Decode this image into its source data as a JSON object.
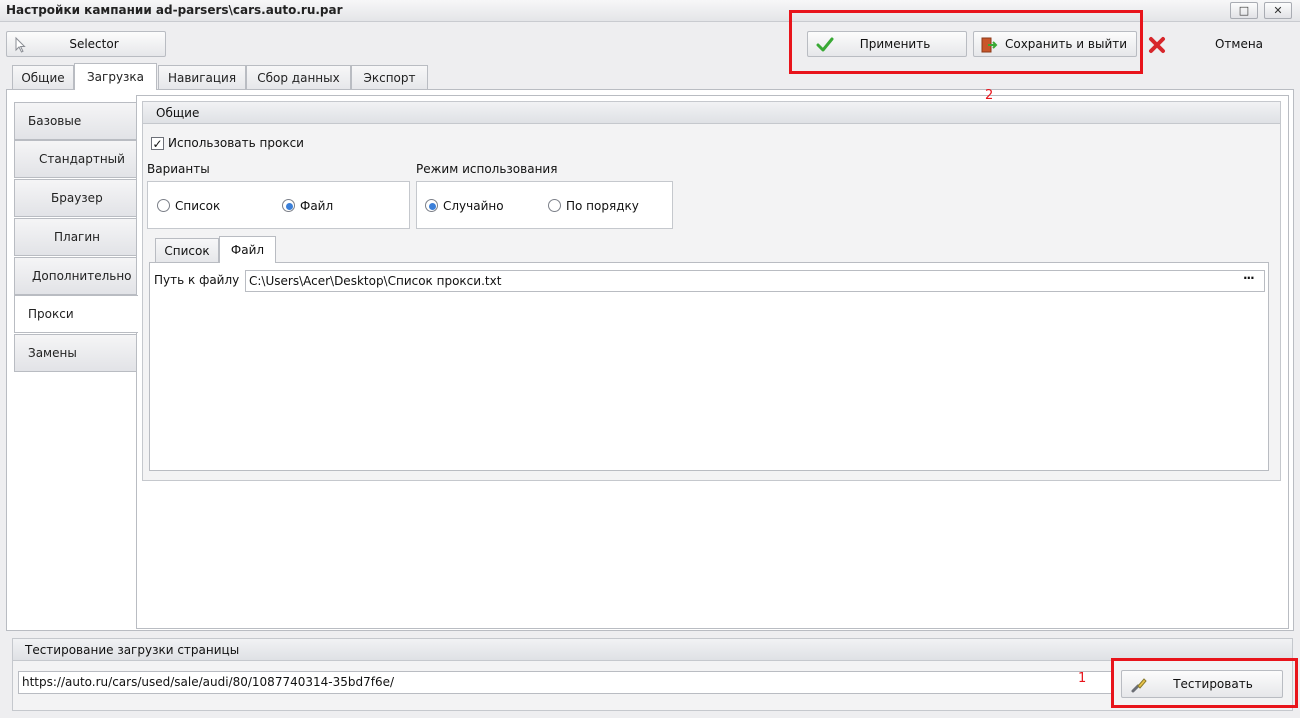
{
  "window": {
    "title": "Настройки кампании ad-parsers\\cars.auto.ru.par",
    "maximize_glyph": "□",
    "close_glyph": "✕"
  },
  "toolbar": {
    "selector_label": "Selector",
    "apply_label": "Применить",
    "save_exit_label": "Сохранить и выйти",
    "cancel_label": "Отмена"
  },
  "tabs": [
    {
      "label": "Общие"
    },
    {
      "label": "Загрузка",
      "active": true
    },
    {
      "label": "Навигация"
    },
    {
      "label": "Сбор данных"
    },
    {
      "label": "Экспорт"
    }
  ],
  "sidebar": {
    "items": [
      {
        "label": "Базовые"
      },
      {
        "label": "Стандартный"
      },
      {
        "label": "Браузер"
      },
      {
        "label": "Плагин"
      },
      {
        "label": "Дополнительно"
      },
      {
        "label": "Прокси",
        "active": true
      },
      {
        "label": "Замены"
      }
    ]
  },
  "proxy": {
    "group_title": "Общие",
    "use_proxy_label": "Использовать прокси",
    "use_proxy_checked": true,
    "variants_label": "Варианты",
    "variant_list": "Список",
    "variant_file": "Файл",
    "selected_variant": "Файл",
    "mode_label": "Режим использования",
    "mode_random": "Случайно",
    "mode_order": "По порядку",
    "selected_mode": "Случайно",
    "subtabs": [
      {
        "label": "Список"
      },
      {
        "label": "Файл",
        "active": true
      }
    ],
    "file_path_label": "Путь к файлу",
    "file_path_value": "C:\\Users\\Acer\\Desktop\\Список прокси.txt",
    "browse_glyph": "···"
  },
  "test": {
    "title": "Тестирование загрузки страницы",
    "url": "https://auto.ru/cars/used/sale/audi/80/1087740314-35bd7f6e/",
    "button_label": "Тестировать"
  },
  "annotations": {
    "marker_1": "1",
    "marker_2": "2",
    "color": "#e8141b"
  },
  "colors": {
    "accent_blue": "#3b7fd8",
    "apply_green": "#39a935",
    "cancel_red": "#d7262b"
  }
}
